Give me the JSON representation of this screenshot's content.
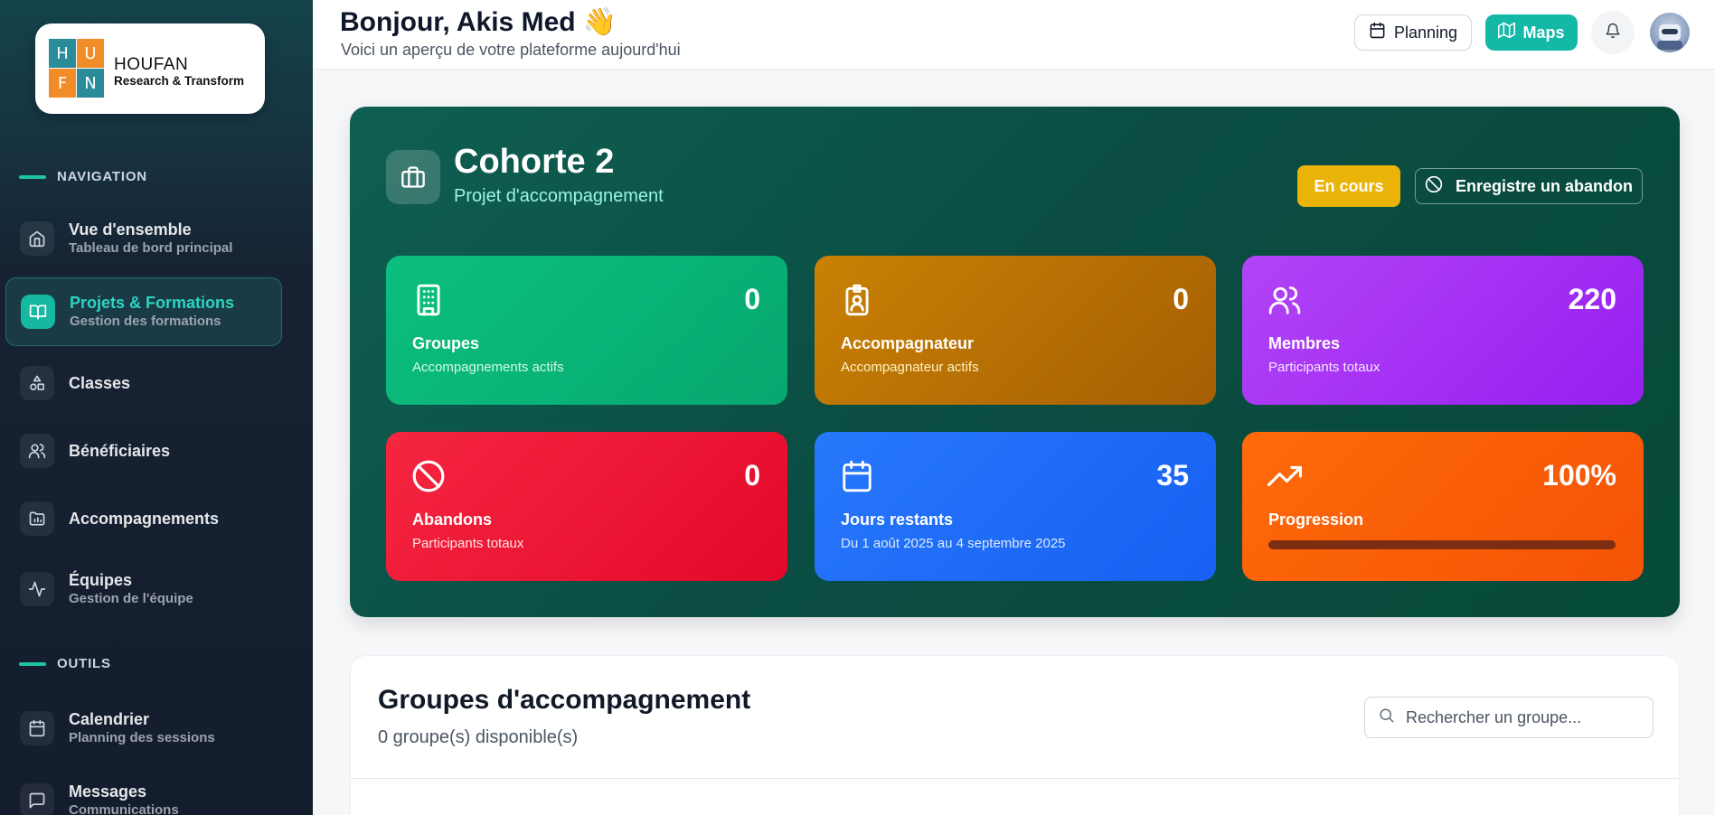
{
  "brand": {
    "letters": [
      "H",
      "U",
      "F",
      "N"
    ],
    "name": "HOUFAN",
    "tagline": "Research & Transform"
  },
  "sidebar": {
    "sections": [
      {
        "title": "NAVIGATION"
      },
      {
        "title": "OUTILS"
      }
    ],
    "items": [
      {
        "label": "Vue d'ensemble",
        "sub": "Tableau de bord principal",
        "icon": "home-icon"
      },
      {
        "label": "Projets & Formations",
        "sub": "Gestion des formations",
        "icon": "book-open-icon",
        "active": true
      },
      {
        "label": "Classes",
        "sub": "",
        "icon": "shapes-icon"
      },
      {
        "label": "Bénéficiaires",
        "sub": "",
        "icon": "users-icon"
      },
      {
        "label": "Accompagnements",
        "sub": "",
        "icon": "folder-icon"
      },
      {
        "label": "Équipes",
        "sub": "Gestion de l'équipe",
        "icon": "activity-icon"
      },
      {
        "label": "Calendrier",
        "sub": "Planning des sessions",
        "icon": "calendar-icon"
      },
      {
        "label": "Messages",
        "sub": "Communications",
        "icon": "message-icon"
      }
    ]
  },
  "header": {
    "greeting": "Bonjour, Akis Med 👋",
    "subtitle": "Voici un aperçu de votre plateforme aujourd'hui",
    "planning_label": "Planning",
    "maps_label": "Maps"
  },
  "cohort": {
    "title": "Cohorte 2",
    "subtitle": "Projet d'accompagnement",
    "status": "En cours",
    "abandon_label": "Enregistre un abandon",
    "stats": [
      {
        "label": "Groupes",
        "sub": "Accompagnements actifs",
        "value": "0",
        "icon": "building-icon"
      },
      {
        "label": "Accompagnateur",
        "sub": "Accompagnateur actifs",
        "value": "0",
        "icon": "badge-icon"
      },
      {
        "label": "Membres",
        "sub": "Participants totaux",
        "value": "220",
        "icon": "users-icon"
      },
      {
        "label": "Abandons",
        "sub": "Participants totaux",
        "value": "0",
        "icon": "ban-icon"
      },
      {
        "label": "Jours restants",
        "sub": "Du 1 août 2025 au 4 septembre 2025",
        "value": "35",
        "icon": "calendar-icon"
      },
      {
        "label": "Progression",
        "sub": "",
        "value": "100%",
        "icon": "trending-up-icon",
        "progress": 1.0
      }
    ]
  },
  "groups": {
    "title": "Groupes d'accompagnement",
    "count_text": "0 groupe(s) disponible(s)",
    "search_placeholder": "Rechercher un groupe..."
  },
  "colors": {
    "accent": "#14b8a6",
    "status": "#eab308",
    "groupes": "#08b377",
    "accompagnateur": "#b86c04",
    "membres": "#a02ff5",
    "abandons": "#ef1a38",
    "jours": "#1d6cf8",
    "progression": "#fb5d08"
  }
}
